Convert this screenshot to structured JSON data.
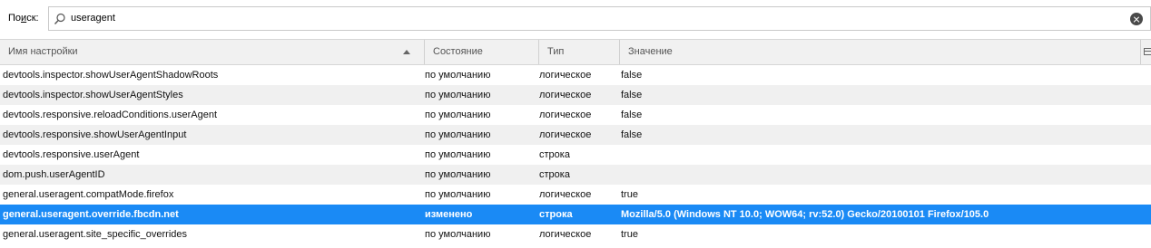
{
  "search": {
    "label_prefix": "По",
    "label_accel": "и",
    "label_suffix": "ск:",
    "value": "useragent"
  },
  "columns": {
    "name": "Имя настройки",
    "state": "Состояние",
    "type": "Тип",
    "value": "Значение"
  },
  "rows": [
    {
      "name": "devtools.inspector.showUserAgentShadowRoots",
      "state": "по умолчанию",
      "type": "логическое",
      "value": "false"
    },
    {
      "name": "devtools.inspector.showUserAgentStyles",
      "state": "по умолчанию",
      "type": "логическое",
      "value": "false"
    },
    {
      "name": "devtools.responsive.reloadConditions.userAgent",
      "state": "по умолчанию",
      "type": "логическое",
      "value": "false"
    },
    {
      "name": "devtools.responsive.showUserAgentInput",
      "state": "по умолчанию",
      "type": "логическое",
      "value": "false"
    },
    {
      "name": "devtools.responsive.userAgent",
      "state": "по умолчанию",
      "type": "строка",
      "value": ""
    },
    {
      "name": "dom.push.userAgentID",
      "state": "по умолчанию",
      "type": "строка",
      "value": ""
    },
    {
      "name": "general.useragent.compatMode.firefox",
      "state": "по умолчанию",
      "type": "логическое",
      "value": "true"
    },
    {
      "name": "general.useragent.override.fbcdn.net",
      "state": "изменено",
      "type": "строка",
      "value": "Mozilla/5.0 (Windows NT 10.0; WOW64; rv:52.0) Gecko/20100101 Firefox/105.0"
    },
    {
      "name": "general.useragent.site_specific_overrides",
      "state": "по умолчанию",
      "type": "логическое",
      "value": "true"
    }
  ],
  "selected_row": 7,
  "colors": {
    "selection": "#1a8af5",
    "header_bg": "#f1f1f1",
    "alt_row": "#f0f0f0"
  },
  "icons": {
    "search": "search-icon",
    "clear": "clear-icon",
    "sort": "sort-ascending-icon",
    "column_picker": "column-picker-icon"
  }
}
